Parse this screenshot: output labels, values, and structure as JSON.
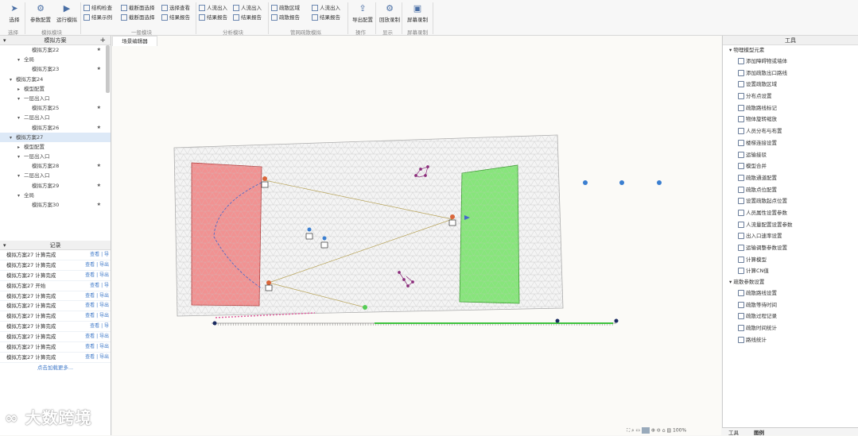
{
  "ribbon": {
    "buttons": [
      {
        "id": "select",
        "label": "选择",
        "icon": "cursor-icon"
      },
      {
        "id": "param",
        "label": "参数配置",
        "icon": "gear-icon"
      },
      {
        "id": "run",
        "label": "运行模拟",
        "icon": "play-icon"
      },
      {
        "id": "playback",
        "label": "回放录制",
        "icon": "video-icon"
      },
      {
        "id": "export",
        "label": "导出配置",
        "icon": "export-icon"
      },
      {
        "id": "record",
        "label": "屏幕录制",
        "icon": "record-icon"
      }
    ],
    "small": [
      "结构检查",
      "结果示例",
      "截断面选择",
      "截断面选择",
      "选择查看",
      "结果报告",
      "人流出入",
      "结果报告",
      "人流出入",
      "结果报告",
      "疏散区域",
      "疏散报告",
      "人流出入",
      "结果报告"
    ],
    "groups": [
      "选择",
      "模拟模块",
      "一般模块",
      "分析模块",
      "管网疏散模拟",
      "操作",
      "显示",
      "屏幕录制"
    ]
  },
  "left_panel": {
    "title": "模拟方案",
    "tree": [
      {
        "label": "模拟方案22",
        "level": 2,
        "star": true,
        "expand": ""
      },
      {
        "label": "全局",
        "level": 1,
        "star": false,
        "expand": "▾"
      },
      {
        "label": "模拟方案23",
        "level": 2,
        "star": true,
        "expand": ""
      },
      {
        "label": "模拟方案24",
        "level": 0,
        "star": false,
        "expand": "▾"
      },
      {
        "label": "模型配置",
        "level": 1,
        "star": false,
        "expand": "▸"
      },
      {
        "label": "一层出入口",
        "level": 1,
        "star": false,
        "expand": "▾"
      },
      {
        "label": "模拟方案25",
        "level": 2,
        "star": true,
        "expand": ""
      },
      {
        "label": "二层出入口",
        "level": 1,
        "star": false,
        "expand": "▾"
      },
      {
        "label": "模拟方案26",
        "level": 2,
        "star": true,
        "expand": ""
      },
      {
        "label": "模拟方案27",
        "level": 0,
        "star": false,
        "expand": "▾",
        "selected": true
      },
      {
        "label": "模型配置",
        "level": 1,
        "star": false,
        "expand": "▸"
      },
      {
        "label": "一层出入口",
        "level": 1,
        "star": false,
        "expand": "▾"
      },
      {
        "label": "模拟方案28",
        "level": 2,
        "star": true,
        "expand": ""
      },
      {
        "label": "二层出入口",
        "level": 1,
        "star": false,
        "expand": "▾"
      },
      {
        "label": "模拟方案29",
        "level": 2,
        "star": true,
        "expand": ""
      },
      {
        "label": "全局",
        "level": 1,
        "star": false,
        "expand": "▾"
      },
      {
        "label": "模拟方案30",
        "level": 2,
        "star": true,
        "expand": ""
      }
    ],
    "results_title": "记录",
    "results": [
      {
        "text": "模拟方案27 计算完成",
        "action": "查看 | 导"
      },
      {
        "text": "模拟方案27 计算完成",
        "action": "查看 | 导出"
      },
      {
        "text": "模拟方案27 计算完成",
        "action": "查看 | 导出"
      },
      {
        "text": "模拟方案27 开始",
        "action": "查看 | 导"
      },
      {
        "text": "模拟方案27 计算完成",
        "action": "查看 | 导出"
      },
      {
        "text": "模拟方案27 计算完成",
        "action": "查看 | 导出"
      },
      {
        "text": "模拟方案27 计算完成",
        "action": "查看 | 导出"
      },
      {
        "text": "模拟方案27 计算完成",
        "action": "查看 | 导"
      },
      {
        "text": "模拟方案27 计算完成",
        "action": "查看 | 导出"
      },
      {
        "text": "模拟方案27 计算完成",
        "action": "查看 | 导出"
      },
      {
        "text": "模拟方案27 计算完成",
        "action": "查看 | 导出"
      }
    ],
    "more_link": "点击加载更多..."
  },
  "center": {
    "tab": "场景编辑器",
    "colors": {
      "red_zone": "#f08080",
      "green_zone": "#7be36e",
      "line": "#b8a45a",
      "blue_line": "#4466cc"
    }
  },
  "right_panel": {
    "title": "工具",
    "section1": "物理模型元素",
    "tools1": [
      "添加障碍物或墙体",
      "添加疏散出口路线",
      "设置疏散区域",
      "分布点设置",
      "疏散路线标记",
      "物体旋转缩放",
      "人员分布与布置",
      "楼梯连接设置",
      "运输接驳",
      "模型合并",
      "疏散通道配置",
      "疏散点位配置",
      "设置疏散起点位置",
      "人员属性设置参数",
      "人流量配置设置参数",
      "出入口速率设置",
      "运输调整参数设置",
      "计算模型"
    ],
    "tool_cn": "计算CN值",
    "section2": "疏散参数设置",
    "tools2": [
      "疏散路线设置",
      "疏散等待时间",
      "疏散过程记录",
      "疏散时间统计",
      "路线统计"
    ]
  },
  "status": {
    "zoom_label": "100%"
  },
  "bottom_tabs": [
    "工具",
    "图例"
  ],
  "watermark": "大数跨境"
}
